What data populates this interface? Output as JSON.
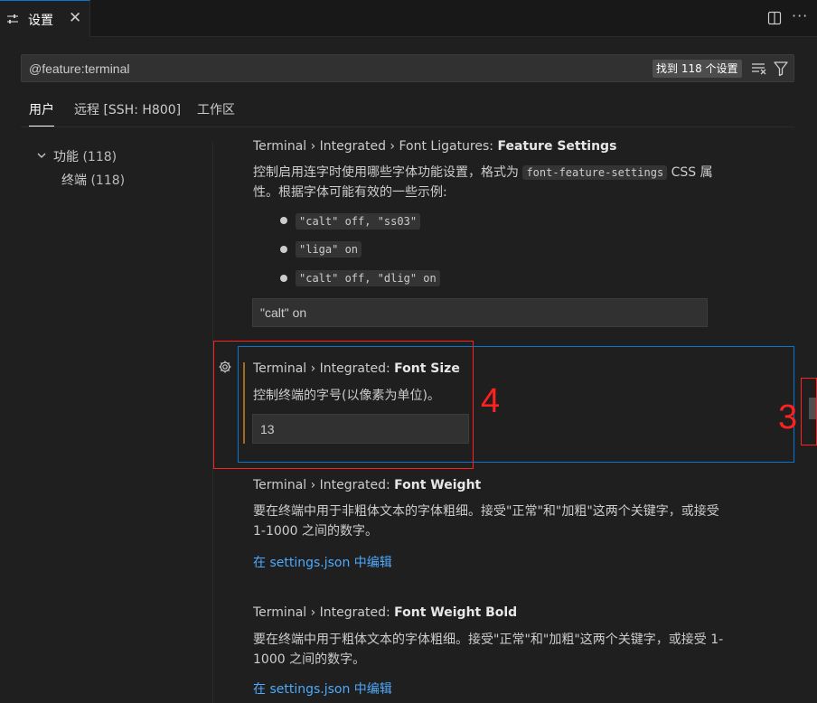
{
  "tab": {
    "title": "设置",
    "close": "✕",
    "more": "···"
  },
  "search": {
    "value": "@feature:terminal",
    "result_count": "找到 118 个设置"
  },
  "scope_tabs": [
    "用户",
    "远程 [SSH: H800]",
    "工作区"
  ],
  "toc": {
    "group": "功能",
    "group_count": "(118)",
    "item": "终端",
    "item_count": "(118)"
  },
  "settings": {
    "ligatures": {
      "prefix": "Terminal › Integrated › Font Ligatures: ",
      "name": "Feature Settings",
      "desc_a": "控制启用连字时使用哪些字体功能设置，格式为",
      "desc_code": "font-feature-settings",
      "desc_b": "CSS 属",
      "desc_c": "性。根据字体可能有效的一些示例:",
      "examples": [
        "\"calt\" off, \"ss03\"",
        "\"liga\" on",
        "\"calt\" off, \"dlig\" on"
      ],
      "value": "\"calt\" on"
    },
    "font_size": {
      "prefix": "Terminal › Integrated: ",
      "name": "Font Size",
      "desc": "控制终端的字号(以像素为单位)。",
      "value": "13"
    },
    "font_weight": {
      "prefix": "Terminal › Integrated: ",
      "name": "Font Weight",
      "desc_1": "要在终端中用于非粗体文本的字体粗细。接受\"正常\"和\"加粗\"这两个关键字，或接受",
      "desc_2": "1-1000 之间的数字。",
      "link": "在 settings.json 中编辑"
    },
    "font_weight_bold": {
      "prefix": "Terminal › Integrated: ",
      "name": "Font Weight Bold",
      "desc_1": "要在终端中用于粗体文本的字体粗细。接受\"正常\"和\"加粗\"这两个关键字，或接受 1-",
      "desc_2": "1000 之间的数字。",
      "link": "在 settings.json 中编辑"
    }
  },
  "annotations": {
    "label_4": "4",
    "label_3": "3"
  },
  "colors": {
    "accent": "#0078d4",
    "annotation": "#ff2020",
    "link": "#4daafc",
    "modified": "#a36b1f"
  }
}
